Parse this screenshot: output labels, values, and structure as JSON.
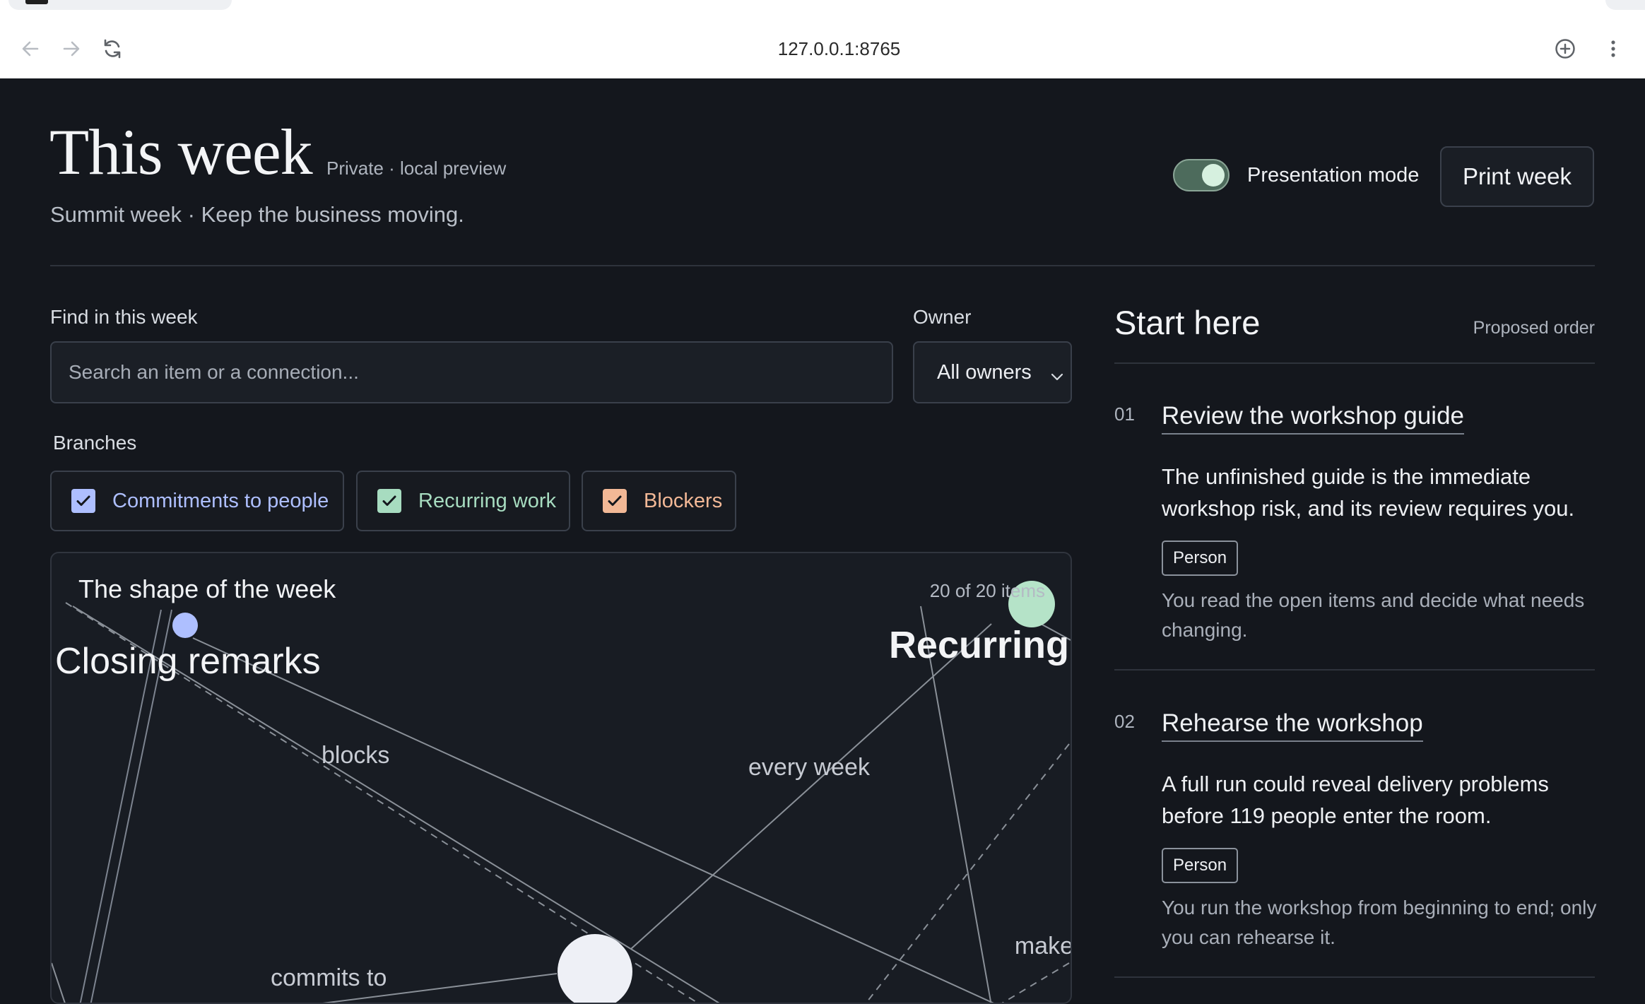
{
  "browser": {
    "url": "127.0.0.1:8765",
    "icons": [
      "back-arrow-icon",
      "forward-arrow-icon",
      "reload-icon",
      "add-to-page-icon",
      "kebab-menu-icon"
    ]
  },
  "header": {
    "title": "This week",
    "visibility": "Private · local preview",
    "subtitle": "Summit week · Keep the business moving.",
    "presentation_label": "Presentation mode",
    "presentation_on": true,
    "print_label": "Print week"
  },
  "filters": {
    "find_label": "Find in this week",
    "search_placeholder": "Search an item or a connection...",
    "owner_label": "Owner",
    "owner_value": "All owners",
    "branches_label": "Branches",
    "branches": [
      {
        "label": "Commitments to people",
        "checked": true,
        "color": "#aebfff"
      },
      {
        "label": "Recurring work",
        "checked": true,
        "color": "#a7dcc0"
      },
      {
        "label": "Blockers",
        "checked": true,
        "color": "#f2b896"
      }
    ]
  },
  "graph": {
    "title": "The shape of the week",
    "count": "20 of 20 items",
    "labels": {
      "closing": "Closing remarks",
      "recurring": "Recurring",
      "blocks": "blocks",
      "every_week": "every week",
      "commits_to": "commits to",
      "make": "make"
    }
  },
  "start": {
    "title": "Start here",
    "order_label": "Proposed order",
    "items": [
      {
        "num": "01",
        "title": "Review the workshop guide",
        "body": "The unfinished guide is the immediate workshop risk, and its review requires you.",
        "tag": "Person",
        "note": "You read the open items and decide what needs changing."
      },
      {
        "num": "02",
        "title": "Rehearse the workshop",
        "body": "A full run could reveal delivery problems before 119 people enter the room.",
        "tag": "Person",
        "note": "You run the workshop from beginning to end; only you can rehearse it."
      }
    ]
  }
}
